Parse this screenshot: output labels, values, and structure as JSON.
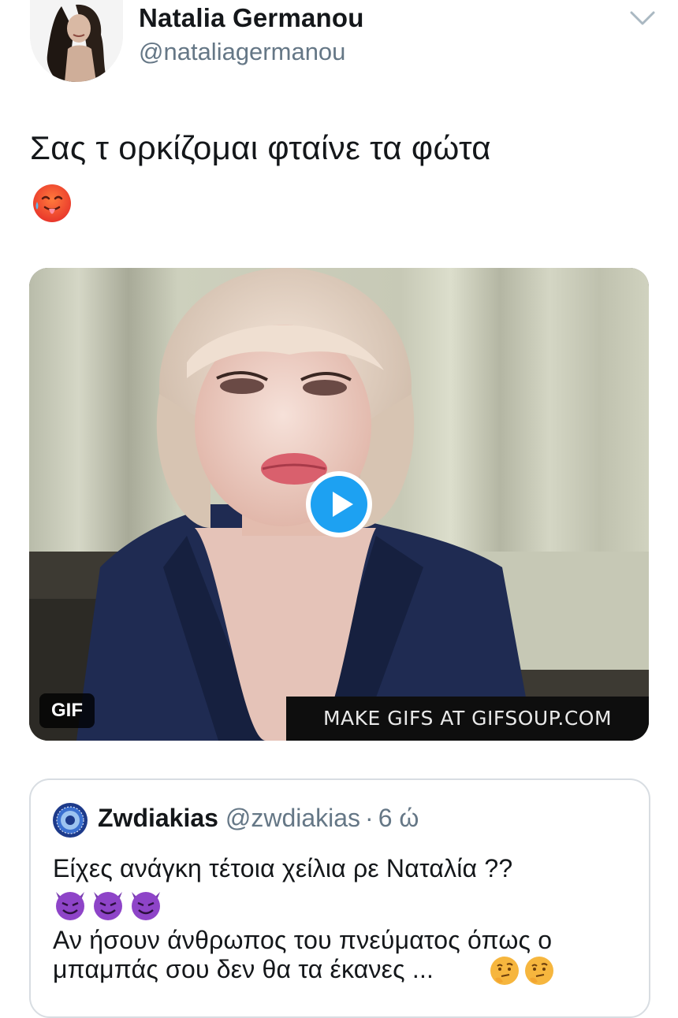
{
  "tweet": {
    "author_name": "Natalia Germanou",
    "author_handle": "@nataliagermanou",
    "text": "Σας τ ορκίζομαι φταίνε τα φώτα",
    "text_emoji": "hot-face",
    "media": {
      "badge": "GIF",
      "watermark": "MAKE GIFS AT GIFSOUP.COM",
      "play_icon": "play-icon"
    },
    "more_icon": "chevron-down-icon"
  },
  "quote": {
    "author_name": "Zwdiakias",
    "author_handle": "@zwdiakias",
    "separator": "·",
    "time": "6 ώ",
    "line1": "Είχες ανάγκη τέτοια χείλια ρε Ναταλία ??",
    "line1_emoji": [
      "smiling-imp",
      "smiling-imp",
      "smiling-imp"
    ],
    "line2": "Αν ήσουν άνθρωπος του πνεύματος όπως ο",
    "line3": "μπαμπάς σου δεν θα τα έκανες ...",
    "line3_emoji": [
      "thinking-face",
      "thinking-face"
    ]
  },
  "colors": {
    "text": "#14171a",
    "secondary": "#657786",
    "border": "#d8dde2",
    "play": "#1da1f2"
  }
}
